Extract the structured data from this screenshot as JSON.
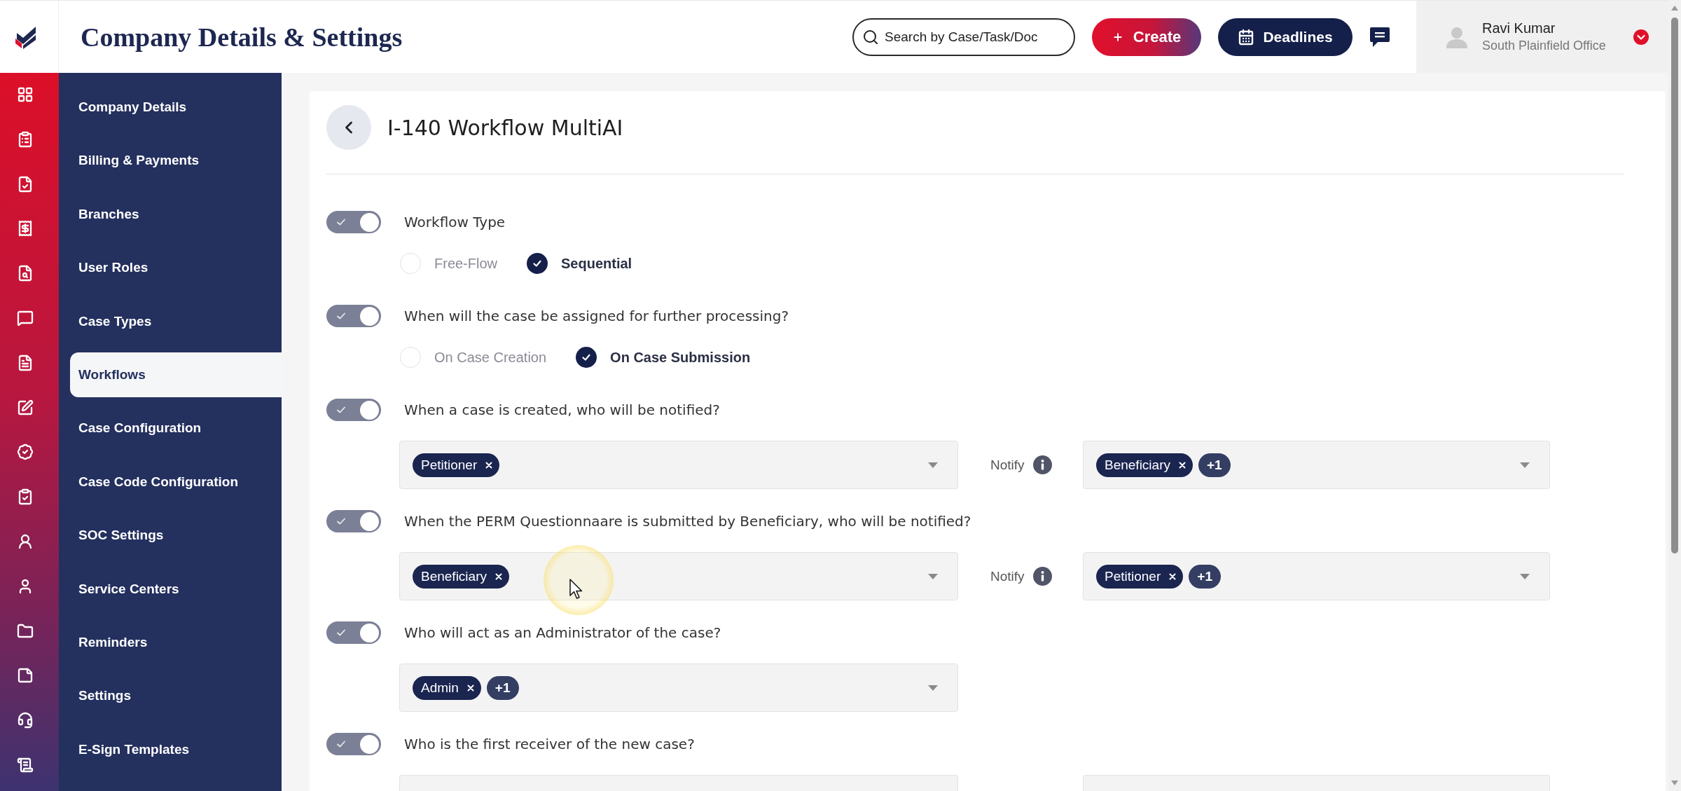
{
  "header": {
    "title": "Company Details & Settings",
    "search": {
      "placeholder": "Search by Case/Task/Doc"
    },
    "create_button": {
      "label": "Create"
    },
    "deadlines_button": {
      "label": "Deadlines"
    },
    "user": {
      "name": "Ravi Kumar",
      "office": "South Plainfield Office"
    }
  },
  "sidebar": {
    "items": [
      {
        "label": "Company Details",
        "selected": false
      },
      {
        "label": "Billing & Payments",
        "selected": false
      },
      {
        "label": "Branches",
        "selected": false
      },
      {
        "label": "User Roles",
        "selected": false
      },
      {
        "label": "Case Types",
        "selected": false
      },
      {
        "label": "Workflows",
        "selected": true
      },
      {
        "label": "Case Configuration",
        "selected": false
      },
      {
        "label": "Case Code Configuration",
        "selected": false
      },
      {
        "label": "SOC Settings",
        "selected": false
      },
      {
        "label": "Service Centers",
        "selected": false
      },
      {
        "label": "Reminders",
        "selected": false
      },
      {
        "label": "Settings",
        "selected": false
      },
      {
        "label": "E-Sign Templates",
        "selected": false
      }
    ]
  },
  "page": {
    "title": "I-140 Workflow MultiAI",
    "settings": [
      {
        "kind": "radio",
        "enabled": true,
        "question": "Workflow Type",
        "options": [
          {
            "label": "Free-Flow",
            "selected": false
          },
          {
            "label": "Sequential",
            "selected": true
          }
        ]
      },
      {
        "kind": "radio",
        "enabled": true,
        "question": "When will the case be assigned for further processing?",
        "options": [
          {
            "label": "On Case Creation",
            "selected": false
          },
          {
            "label": "On Case Submission",
            "selected": true
          }
        ]
      },
      {
        "kind": "notify",
        "enabled": true,
        "question": "When a case is created, who will be notified?",
        "recipients": {
          "chips": [
            "Petitioner"
          ]
        },
        "notify_label": "Notify",
        "notify_recipients": {
          "chips": [
            "Beneficiary"
          ],
          "more": "+1"
        }
      },
      {
        "kind": "notify",
        "enabled": true,
        "question": "When the PERM Questionnaare is submitted by Beneficiary, who will be notified?",
        "recipients": {
          "chips": [
            "Beneficiary"
          ]
        },
        "notify_label": "Notify",
        "notify_recipients": {
          "chips": [
            "Petitioner"
          ],
          "more": "+1"
        }
      },
      {
        "kind": "select",
        "enabled": true,
        "question": "Who will act as an Administrator of the case?",
        "recipients": {
          "chips": [
            "Admin"
          ],
          "more": "+1"
        }
      },
      {
        "kind": "notify",
        "enabled": true,
        "question": "Who is the first receiver of the new case?"
      }
    ]
  }
}
